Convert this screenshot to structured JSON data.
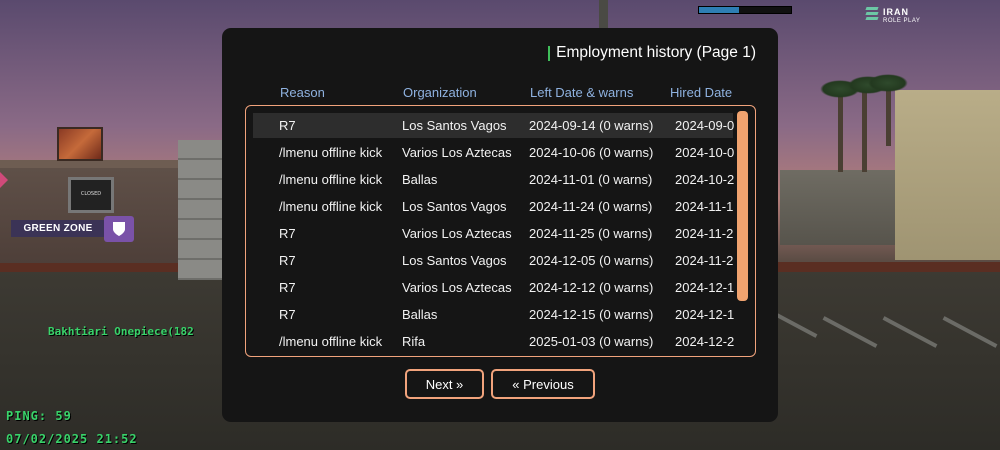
{
  "hud": {
    "health_bar_fraction": 0.44,
    "logo_line1": "IRAN",
    "logo_line2": "ROLE PLAY",
    "zone_label": "GREEN ZONE",
    "player_name": "Bakhtiari Onepiece(182",
    "ping": "PING: 59",
    "datetime": "07/02/2025 21:52",
    "sign_text": "CLOSED"
  },
  "dialog": {
    "title": "Employment history (Page 1)",
    "columns": [
      "Reason",
      "Organization",
      "Left Date & warns",
      "Hired Date"
    ],
    "rows": [
      {
        "reason": "R7",
        "organization": "Los Santos Vagos",
        "left": "2024-09-14 (0 warns)",
        "hired": "2024-09-0"
      },
      {
        "reason": "/lmenu offline kick",
        "organization": "Varios Los Aztecas",
        "left": "2024-10-06 (0 warns)",
        "hired": "2024-10-0"
      },
      {
        "reason": "/lmenu offline kick",
        "organization": "Ballas",
        "left": "2024-11-01 (0 warns)",
        "hired": "2024-10-2"
      },
      {
        "reason": "/lmenu offline kick",
        "organization": "Los Santos Vagos",
        "left": "2024-11-24 (0 warns)",
        "hired": "2024-11-1"
      },
      {
        "reason": "R7",
        "organization": "Varios Los Aztecas",
        "left": "2024-11-25 (0 warns)",
        "hired": "2024-11-2"
      },
      {
        "reason": "R7",
        "organization": "Los Santos Vagos",
        "left": "2024-12-05 (0 warns)",
        "hired": "2024-11-2"
      },
      {
        "reason": "R7",
        "organization": "Varios Los Aztecas",
        "left": "2024-12-12 (0 warns)",
        "hired": "2024-12-1"
      },
      {
        "reason": "R7",
        "organization": "Ballas",
        "left": "2024-12-15 (0 warns)",
        "hired": "2024-12-1"
      },
      {
        "reason": "/lmenu offline kick",
        "organization": "Rifa",
        "left": "2025-01-03 (0 warns)",
        "hired": "2024-12-2"
      }
    ],
    "selected_row": 0,
    "buttons": {
      "next": "Next »",
      "previous": "« Previous"
    }
  },
  "colors": {
    "accent_border": "#f1a37c",
    "scrollbar": "#f0a36f",
    "header_text": "#8fb2e0",
    "hud_green": "#39d36a",
    "title_accent": "#3fbf5a"
  }
}
